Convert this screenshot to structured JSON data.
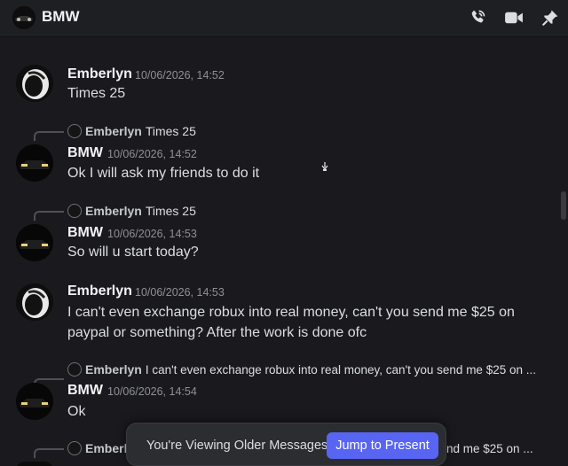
{
  "header": {
    "title": "BMW",
    "icons": [
      "phone-call-icon",
      "video-camera-icon",
      "pin-icon"
    ]
  },
  "messages": [
    {
      "author": "Emberlyn",
      "timestamp": "10/06/2026, 14:52",
      "text": "Times 25"
    },
    {
      "reply_to": {
        "author": "Emberlyn",
        "text": "Times 25"
      },
      "author": "BMW",
      "timestamp": "10/06/2026, 14:52",
      "text": "Ok I will ask my friends to do it"
    },
    {
      "reply_to": {
        "author": "Emberlyn",
        "text": "Times 25"
      },
      "author": "BMW",
      "timestamp": "10/06/2026, 14:53",
      "text": "So will u start today?"
    },
    {
      "author": "Emberlyn",
      "timestamp": "10/06/2026, 14:53",
      "text_line1": "I can't even exchange robux into real money, can't you send me $25 on",
      "text_line2": "paypal or something? After the work is done ofc"
    },
    {
      "reply_to": {
        "author": "Emberlyn",
        "text": "I can't even exchange robux into real money, can't you send me $25 on ..."
      },
      "author": "BMW",
      "timestamp": "10/06/2026, 14:54",
      "text": "Ok"
    },
    {
      "reply_to": {
        "author": "Emberl",
        "text": "nd me $25 on ..."
      }
    }
  ],
  "older_messages_bar": {
    "text": "You're Viewing Older Messages",
    "button": "Jump to Present"
  },
  "colors": {
    "background": "#1a1a1e",
    "accent": "#5865f2"
  }
}
